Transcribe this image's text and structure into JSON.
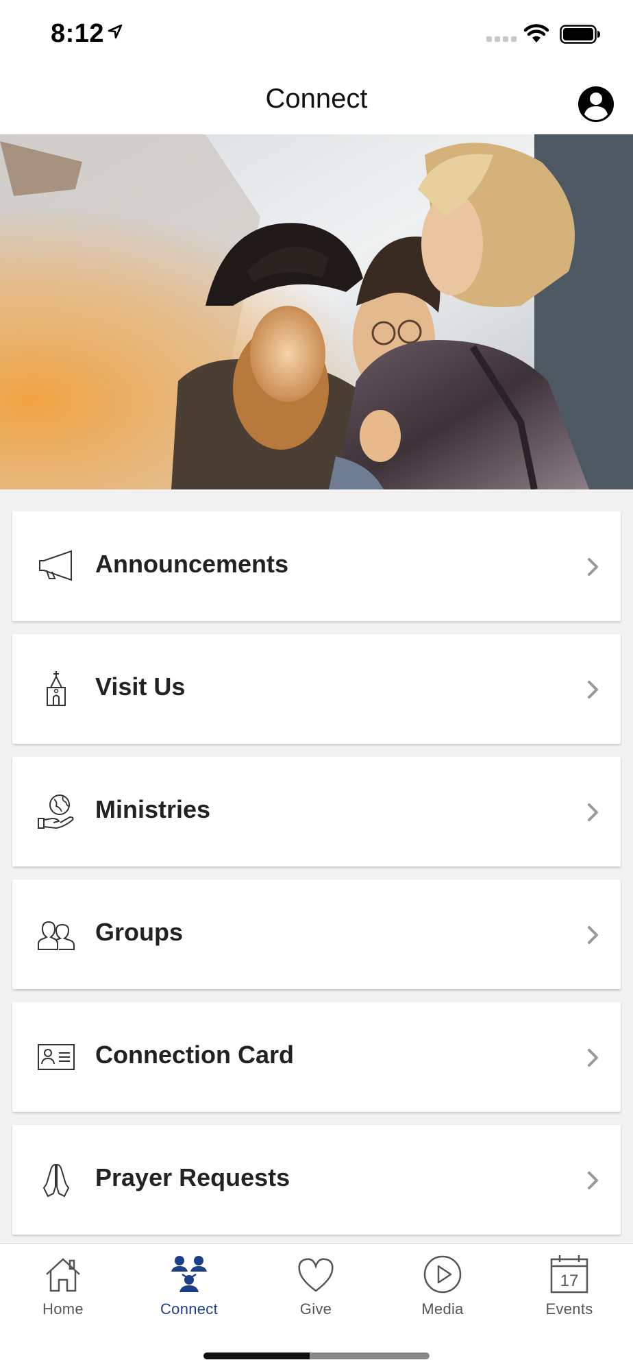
{
  "status_bar": {
    "time": "8:12",
    "icons": [
      "location-arrow-icon",
      "signal-icon",
      "wifi-icon",
      "battery-icon"
    ]
  },
  "header": {
    "title": "Connect",
    "profile_icon": "profile-icon"
  },
  "hero": {
    "icon": "hero-photo"
  },
  "menu": {
    "items": [
      {
        "label": "Announcements",
        "icon": "megaphone-icon"
      },
      {
        "label": "Visit Us",
        "icon": "church-icon"
      },
      {
        "label": "Ministries",
        "icon": "globe-hand-icon"
      },
      {
        "label": "Groups",
        "icon": "people-icon"
      },
      {
        "label": "Connection Card",
        "icon": "id-card-icon"
      },
      {
        "label": "Prayer Requests",
        "icon": "praying-hands-icon"
      }
    ]
  },
  "tab_bar": {
    "active": "Connect",
    "active_color": "#1c3f8c",
    "items": [
      {
        "label": "Home",
        "icon": "home-icon"
      },
      {
        "label": "Connect",
        "icon": "connect-icon"
      },
      {
        "label": "Give",
        "icon": "heart-icon"
      },
      {
        "label": "Media",
        "icon": "play-icon"
      },
      {
        "label": "Events",
        "icon": "calendar-icon",
        "calendar_day": "17"
      }
    ]
  }
}
